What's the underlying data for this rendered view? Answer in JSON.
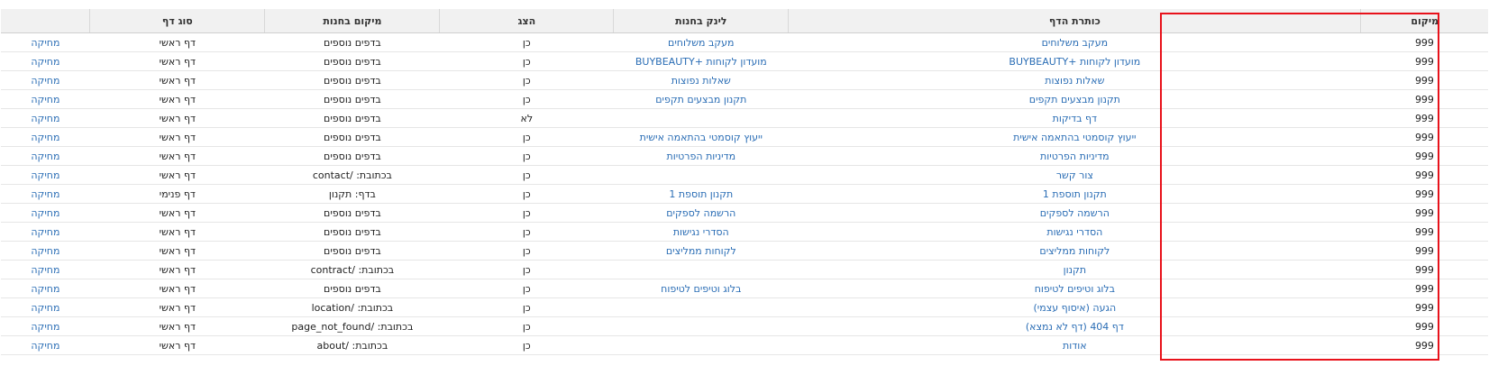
{
  "table": {
    "headers": {
      "position": "מיקום",
      "title": "כותרת הדף",
      "link": "לינק בחנות",
      "show": "הצג",
      "location": "מיקום בחנות",
      "type": "סוג דף",
      "actions": ""
    },
    "rows": [
      {
        "position": "999",
        "title": "מעקב משלוחים",
        "link": "מעקב משלוחים",
        "show": "כן",
        "location": "בדפים נוספים",
        "type": "דף ראשי",
        "delete": "מחיקה"
      },
      {
        "position": "999",
        "title": "מועדון לקוחות +BUYBEAUTY",
        "link": "מועדון לקוחות +BUYBEAUTY",
        "show": "כן",
        "location": "בדפים נוספים",
        "type": "דף ראשי",
        "delete": "מחיקה"
      },
      {
        "position": "999",
        "title": "שאלות נפוצות",
        "link": "שאלות נפוצות",
        "show": "כן",
        "location": "בדפים נוספים",
        "type": "דף ראשי",
        "delete": "מחיקה"
      },
      {
        "position": "999",
        "title": "תקנון מבצעים תקפים",
        "link": "תקנון מבצעים תקפים",
        "show": "כן",
        "location": "בדפים נוספים",
        "type": "דף ראשי",
        "delete": "מחיקה"
      },
      {
        "position": "999",
        "title": "דף בדיקות",
        "link": "",
        "show": "לא",
        "location": "בדפים נוספים",
        "type": "דף ראשי",
        "delete": "מחיקה"
      },
      {
        "position": "999",
        "title": "ייעוץ קוסמטי בהתאמה אישית",
        "link": "ייעוץ קוסמטי בהתאמה אישית",
        "show": "כן",
        "location": "בדפים נוספים",
        "type": "דף ראשי",
        "delete": "מחיקה"
      },
      {
        "position": "999",
        "title": "מדיניות הפרטיות",
        "link": "מדיניות הפרטיות",
        "show": "כן",
        "location": "בדפים נוספים",
        "type": "דף ראשי",
        "delete": "מחיקה"
      },
      {
        "position": "999",
        "title": "צור קשר",
        "link": "",
        "show": "כן",
        "location": "בכתובת: /contact",
        "type": "דף ראשי",
        "delete": "מחיקה"
      },
      {
        "position": "999",
        "title": "תקנון תוספת 1",
        "link": "תקנון תוספת 1",
        "show": "כן",
        "location": "בדף: תקנון",
        "type": "דף פנימי",
        "delete": "מחיקה"
      },
      {
        "position": "999",
        "title": "הרשמה לספקים",
        "link": "הרשמה לספקים",
        "show": "כן",
        "location": "בדפים נוספים",
        "type": "דף ראשי",
        "delete": "מחיקה"
      },
      {
        "position": "999",
        "title": "הסדרי נגישות",
        "link": "הסדרי נגישות",
        "show": "כן",
        "location": "בדפים נוספים",
        "type": "דף ראשי",
        "delete": "מחיקה"
      },
      {
        "position": "999",
        "title": "לקוחות ממליצים",
        "link": "לקוחות ממליצים",
        "show": "כן",
        "location": "בדפים נוספים",
        "type": "דף ראשי",
        "delete": "מחיקה"
      },
      {
        "position": "999",
        "title": "תקנון",
        "link": "",
        "show": "כן",
        "location": "בכתובת: /contract",
        "type": "דף ראשי",
        "delete": "מחיקה"
      },
      {
        "position": "999",
        "title": "בלוג וטיפים לטיפוח",
        "link": "בלוג וטיפים לטיפוח",
        "show": "כן",
        "location": "בדפים נוספים",
        "type": "דף ראשי",
        "delete": "מחיקה"
      },
      {
        "position": "999",
        "title": "הגעה (איסוף עצמי)",
        "link": "",
        "show": "כן",
        "location": "בכתובת: /location",
        "type": "דף ראשי",
        "delete": "מחיקה"
      },
      {
        "position": "999",
        "title": "דף 404 (דף לא נמצא)",
        "link": "",
        "show": "כן",
        "location": "בכתובת: /page_not_found",
        "type": "דף ראשי",
        "delete": "מחיקה"
      },
      {
        "position": "999",
        "title": "אודות",
        "link": "",
        "show": "כן",
        "location": "בכתובת: /about",
        "type": "דף ראשי",
        "delete": "מחיקה"
      }
    ]
  },
  "colors": {
    "link": "#2a6db5",
    "highlight": "#e8121b",
    "header_bg": "#f1f1f1"
  }
}
